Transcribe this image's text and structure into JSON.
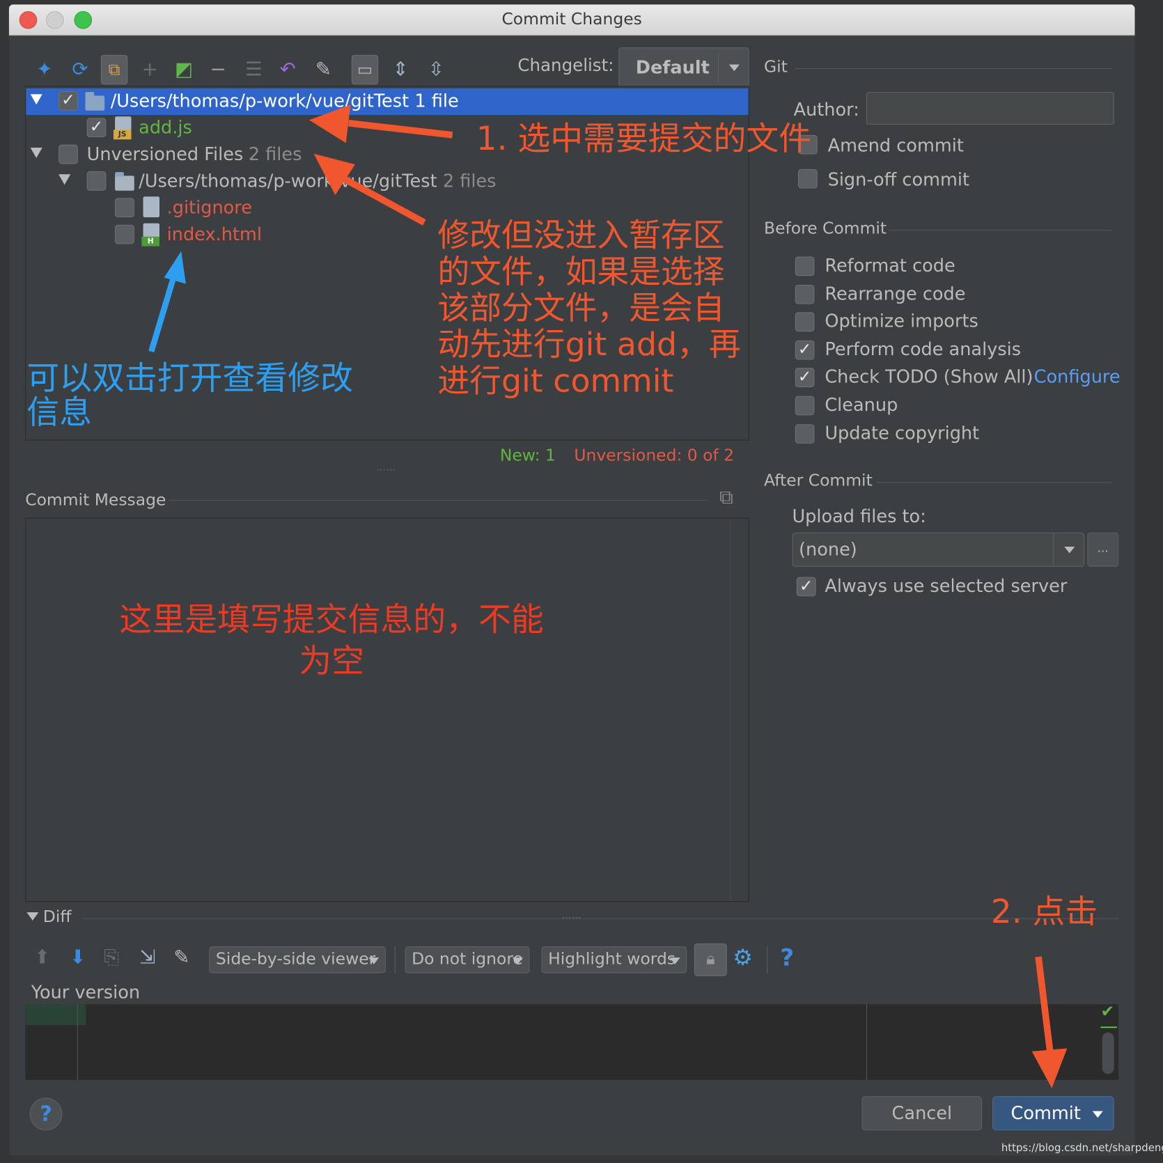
{
  "window": {
    "title": "Commit Changes"
  },
  "toolbar": {
    "changelist_label": "Changelist:",
    "changelist_value": "Default"
  },
  "tree": {
    "root_path": "/Users/thomas/p-work/vue/gitTest",
    "root_count": "1 file",
    "file1": "add.js",
    "unversioned_label": "Unversioned Files",
    "unversioned_count": "2 files",
    "sub_path": "/Users/thomas/p-work/vue/gitTest",
    "sub_count": "2 files",
    "file2": ".gitignore",
    "file3": "index.html"
  },
  "status": {
    "new": "New: 1",
    "unversioned": "Unversioned: 0 of 2"
  },
  "commit_message": {
    "label": "Commit Message"
  },
  "git": {
    "section": "Git",
    "author_label": "Author:",
    "author_value": "",
    "amend": "Amend commit",
    "signoff": "Sign-off commit"
  },
  "before_commit": {
    "section": "Before Commit",
    "items": [
      {
        "label": "Reformat code",
        "checked": false
      },
      {
        "label": "Rearrange code",
        "checked": false
      },
      {
        "label": "Optimize imports",
        "checked": false
      },
      {
        "label": "Perform code analysis",
        "checked": true
      },
      {
        "label": "Check TODO (Show All)",
        "checked": true
      },
      {
        "label": "Cleanup",
        "checked": false
      },
      {
        "label": "Update copyright",
        "checked": false
      }
    ],
    "configure_link": "Configure"
  },
  "after_commit": {
    "section": "After Commit",
    "upload_label": "Upload files to:",
    "upload_value": "(none)",
    "more": "...",
    "always_use": "Always use selected server"
  },
  "diff": {
    "label": "Diff",
    "viewer": "Side-by-side viewer",
    "ignore": "Do not ignore",
    "highlight": "Highlight words",
    "help": "?",
    "your_version": "Your version"
  },
  "buttons": {
    "help": "?",
    "cancel": "Cancel",
    "commit": "Commit"
  },
  "annotations": {
    "a1": "1. 选中需要提交的文件",
    "a2": [
      "修改但没进入暂存区",
      "的文件，如果是选择",
      "该部分文件，是会自",
      "动先进行git add，再",
      "进行git commit"
    ],
    "a3": [
      "可以双击打开查看修改",
      "信息"
    ],
    "a4": [
      "这里是填写提交信息的，不能",
      "为空"
    ],
    "a5": "2. 点击"
  },
  "watermark": "https://blog.csdn.net/sharpdeng",
  "colors": {
    "selection": "#2f65ca",
    "green_text": "#62b543",
    "red_text": "#e05a4a",
    "link": "#589df6",
    "annot_red": "#f0572e",
    "annot_blue": "#2e9ff0",
    "commit_btn": "#365880"
  }
}
